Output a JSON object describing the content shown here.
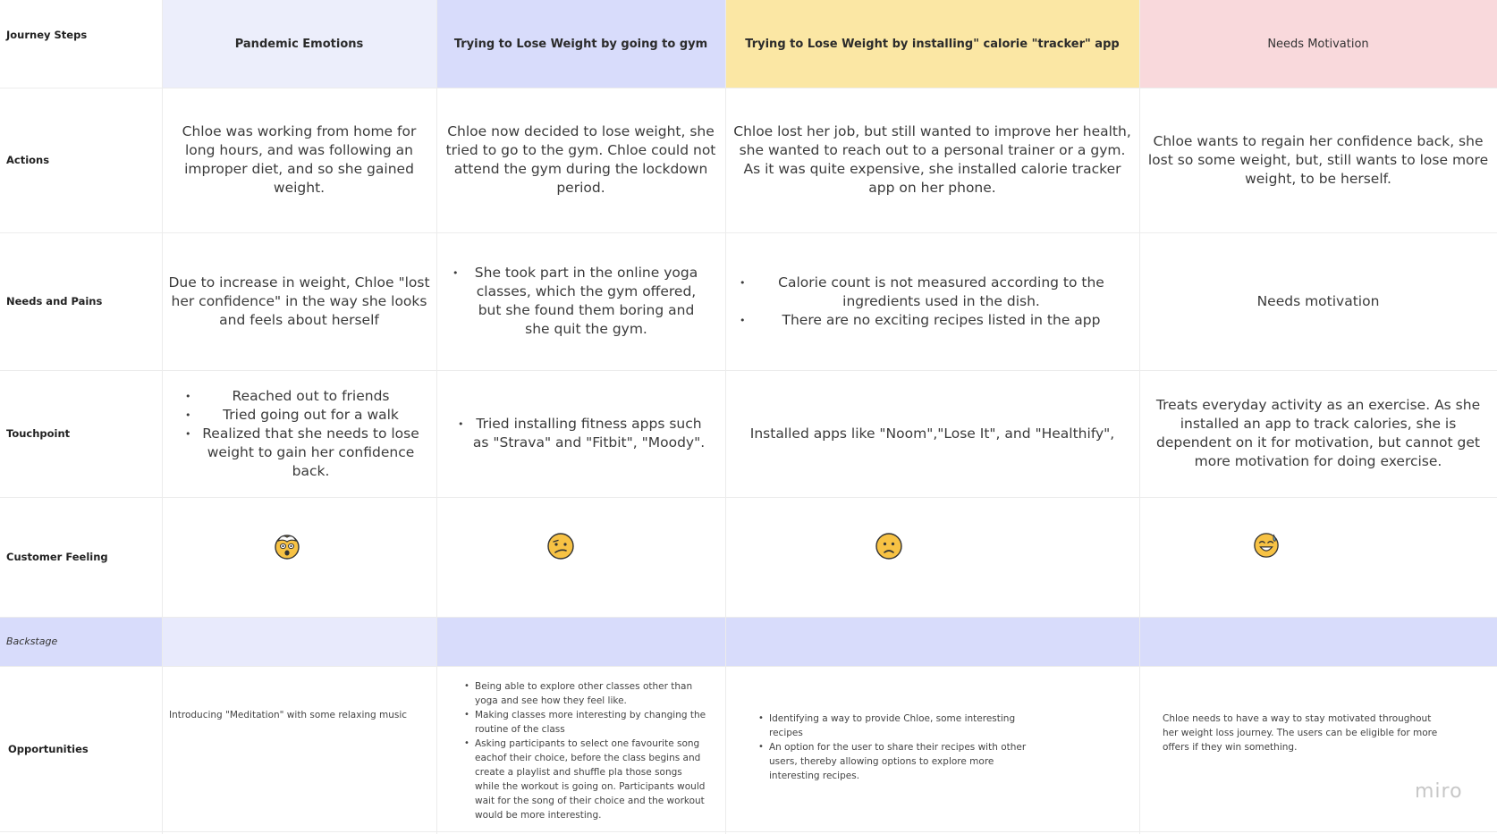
{
  "columns": {
    "header": "Journey Steps",
    "steps": [
      "Pandemic Emotions",
      "Trying to Lose Weight by going to gym",
      "Trying to Lose Weight by installing\" calorie \"tracker\" app",
      "Needs Motivation"
    ]
  },
  "rows": {
    "actions": "Actions",
    "needs": "Needs and Pains",
    "touchpoint": "Touchpoint",
    "feeling": "Customer Feeling",
    "backstage": "Backstage",
    "opportunities": "Opportunities"
  },
  "actions": [
    "Chloe was working from home for long hours, and was following an improper diet,  and so she gained weight.",
    "Chloe now decided to lose weight, she tried to go to the gym. Chloe could not attend the gym during the lockdown period.",
    "Chloe lost her job, but still wanted to improve her health, she wanted to reach out to a personal trainer or a gym. As it was quite expensive, she installed calorie tracker app on her phone.",
    "Chloe wants to regain her confidence back, she lost so some weight, but, still wants to lose more weight, to be herself."
  ],
  "needs": {
    "col1": "Due to increase in weight, Chloe \"lost her confidence\" in the way she looks and feels about herself",
    "col2": [
      "She took part in the online yoga classes, which the gym offered, but she found them boring and she quit the gym."
    ],
    "col3": [
      "Calorie count is not measured according to the ingredients used in the dish.",
      "There are no exciting recipes listed in the app"
    ],
    "col4": "Needs motivation"
  },
  "touchpoint": {
    "col1": [
      "Reached out to friends",
      "Tried going out for a walk",
      "Realized that she needs to lose weight to gain her confidence back."
    ],
    "col2": [
      "Tried installing fitness apps such as \"Strava\" and \"Fitbit\", \"Moody\"."
    ],
    "col3": "Installed apps like \"Noom\",\"Lose It\", and \"Healthify\",",
    "col4": "Treats everyday activity as an exercise. As she installed an app to track calories, she is dependent on it for motivation, but cannot get more motivation for doing exercise."
  },
  "feeling": {
    "icons": [
      "exploding-head-emoji-icon",
      "confused-emoji-icon",
      "slightly-frowning-emoji-icon",
      "grinning-sweat-emoji-icon"
    ]
  },
  "opportunities": {
    "col1": "Introducing \"Meditation\" with some relaxing music",
    "col2": [
      "Being able to explore other classes other than yoga and see how they feel like.",
      "Making classes more interesting by changing the routine of the class",
      "Asking participants to select one favourite song eachof their choice, before the class begins and create a playlist and shuffle pla those songs while the workout is going on. Participants would wait for the song of their choice and the workout would be more interesting."
    ],
    "col3": [
      "Identifying a way to provide Chloe, some interesting recipes",
      "An option for the user to share their recipes with other users, thereby allowing options to explore more interesting recipes."
    ],
    "col4": "Chloe needs to have a way to stay motivated throughout her weight loss journey. The users can be eligible for more offers if they win something."
  },
  "brand": "miro",
  "colors": {
    "lavender": "#eceefb",
    "periwinkle": "#d8dcfb",
    "yellow": "#fbe7a4",
    "pink": "#f9d9dc",
    "backstage_label": "#d8dcfb",
    "backstage_col1": "#e8eafc",
    "emoji": "#f7c244"
  }
}
